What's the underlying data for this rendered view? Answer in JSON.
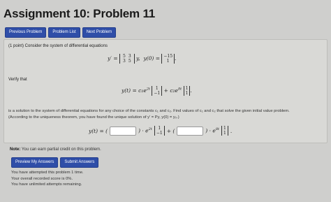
{
  "page": {
    "title": "Assignment 10: Problem 11"
  },
  "nav": {
    "previous": "Previous Problem",
    "list": "Problem List",
    "next": "Next Problem"
  },
  "problem": {
    "intro": "(1 point) Consider the system of differential equations",
    "system": {
      "lhs": "y′ =",
      "matrix": [
        [
          "5",
          "3"
        ],
        [
          "3",
          "5"
        ]
      ],
      "after_matrix": "y,",
      "init_lhs": "y(0) =",
      "init_vec": [
        "−15",
        "1"
      ],
      "end": "."
    },
    "verify_label": "Verify that",
    "solution": {
      "lhs": "y(t) = c₁e",
      "exp1": "2t",
      "vec1": [
        "1",
        "−1"
      ],
      "mid": "+ c₂e",
      "exp2": "8t",
      "vec2": [
        "1",
        "1"
      ],
      "end": "."
    },
    "description": "is a solution to the system of differential equations for any choice of the constants c₁ and c₂. Find values of c₁ and c₂ that solve the given initial value problem. (According to the uniqueness theorem, you have found the unique solution of y′ = Py, y(0) = y₀.)",
    "answer_row": {
      "lhs": "y(t) = (",
      "close1": ") · e",
      "exp1": "2t",
      "vec1": [
        "1",
        "−1"
      ],
      "plus": "+ (",
      "close2": ") · e",
      "exp2": "8t",
      "vec2": [
        "1",
        "1"
      ],
      "end": "."
    }
  },
  "note": {
    "label": "Note:",
    "text": " You can earn partial credit on this problem."
  },
  "actions": {
    "preview": "Preview My Answers",
    "submit": "Submit Answers"
  },
  "status": {
    "attempts": "You have attempted this problem 1 time.",
    "score": "Your overall recorded score is 0%.",
    "remaining": "You have unlimited attempts remaining."
  }
}
